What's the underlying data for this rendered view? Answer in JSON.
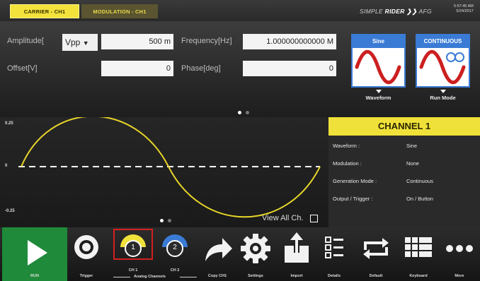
{
  "tabs": [
    {
      "label": "CARRIER - CH1",
      "active": true
    },
    {
      "label": "MODULATION - CH1",
      "active": false
    }
  ],
  "brand": {
    "prefix": "SIMPLE",
    "name": "RIDER",
    "chevrons": "❯❯",
    "suffix": "AFG"
  },
  "clock": {
    "time": "5:57:45 AM",
    "date": "5/24/2017"
  },
  "params": {
    "amplitude_label": "Amplitude[",
    "amplitude_unit": "Vpp",
    "amplitude_value": "500 m",
    "frequency_label": "Frequency[Hz]",
    "frequency_value": "1.000000000000 M",
    "offset_label": "Offset[V]",
    "offset_value": "0",
    "phase_label": "Phase[deg]",
    "phase_value": "0"
  },
  "waveform_box": {
    "header": "Sine",
    "caption": "Waveform"
  },
  "runmode_box": {
    "header": "CONTINUOUS",
    "caption": "Run Mode"
  },
  "graph": {
    "y_top": "0.25",
    "y_mid": "0",
    "y_bottom": "-0.25",
    "view_all_label": "View All Ch."
  },
  "channel": {
    "title": "CHANNEL 1",
    "rows": [
      {
        "label": "Waveform :",
        "value": "Sine"
      },
      {
        "label": "Modulation :",
        "value": "None"
      },
      {
        "label": "Generation Mode :",
        "value": "Continuous"
      },
      {
        "label": "Output / Trigger :",
        "value": "On / Button"
      }
    ]
  },
  "toolbar": {
    "run": "RUN",
    "trigger": "Trigger",
    "ch1": "CH 1",
    "ch1_number": "1",
    "ch2": "CH 2",
    "ch2_number": "2",
    "analog_group": "Analog Channels",
    "copy": "Copy CH1",
    "settings": "Settings",
    "import": "Import",
    "details": "Details",
    "default": "Default",
    "keyboard": "Keyboard",
    "more": "More"
  },
  "colors": {
    "accent_yellow": "#f0e13a",
    "accent_blue": "#3a7bd5",
    "run_green": "#1f8a3a",
    "wave_red": "#cc1f1f",
    "selection_red": "#d32020"
  },
  "icons": [
    "play-icon",
    "trigger-icon",
    "channel-1-icon",
    "channel-2-icon",
    "share-arrow-icon",
    "gear-icon",
    "import-icon",
    "details-list-icon",
    "default-cycle-icon",
    "keyboard-grid-icon",
    "more-dots-icon"
  ]
}
